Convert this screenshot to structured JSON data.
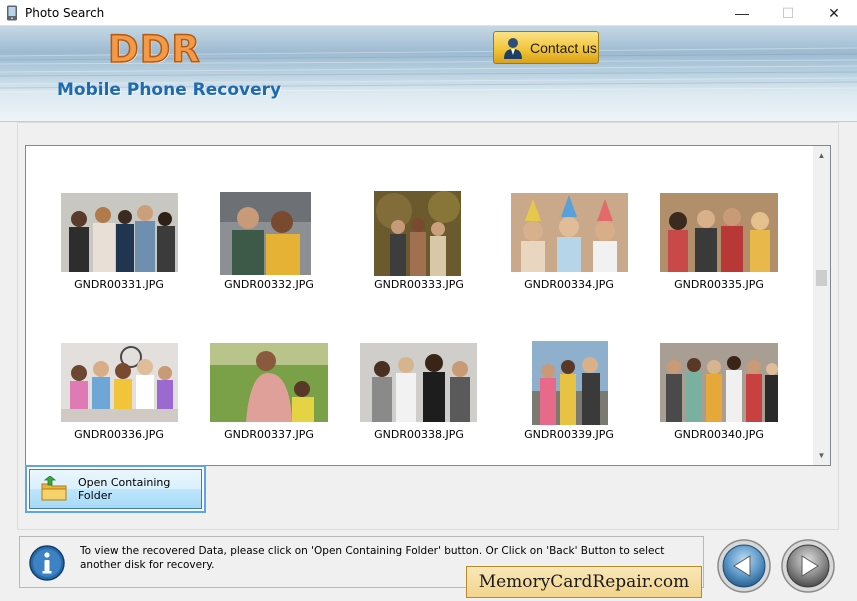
{
  "window": {
    "title": "Photo Search",
    "minimize_glyph": "—",
    "maximize_glyph": "☐",
    "close_glyph": "✕"
  },
  "header": {
    "logo": "DDR",
    "subtitle": "Mobile Phone Recovery",
    "contact_label": "Contact us"
  },
  "photos": [
    {
      "file": "GNDR00331.JPG"
    },
    {
      "file": "GNDR00332.JPG"
    },
    {
      "file": "GNDR00333.JPG"
    },
    {
      "file": "GNDR00334.JPG"
    },
    {
      "file": "GNDR00335.JPG"
    },
    {
      "file": "GNDR00336.JPG"
    },
    {
      "file": "GNDR00337.JPG"
    },
    {
      "file": "GNDR00338.JPG"
    },
    {
      "file": "GNDR00339.JPG"
    },
    {
      "file": "GNDR00340.JPG"
    }
  ],
  "actions": {
    "open_folder_label": "Open Containing Folder"
  },
  "info": {
    "message": "To view the recovered Data, please click on 'Open Containing Folder' button. Or Click on 'Back' Button to select another disk for recovery."
  },
  "brand": {
    "tag": "MemoryCardRepair.com"
  },
  "icons": {
    "app": "phone-icon",
    "contact": "person-icon",
    "folder": "open-folder-icon",
    "info": "info-icon",
    "back": "back-arrow-icon",
    "next": "next-arrow-icon"
  }
}
